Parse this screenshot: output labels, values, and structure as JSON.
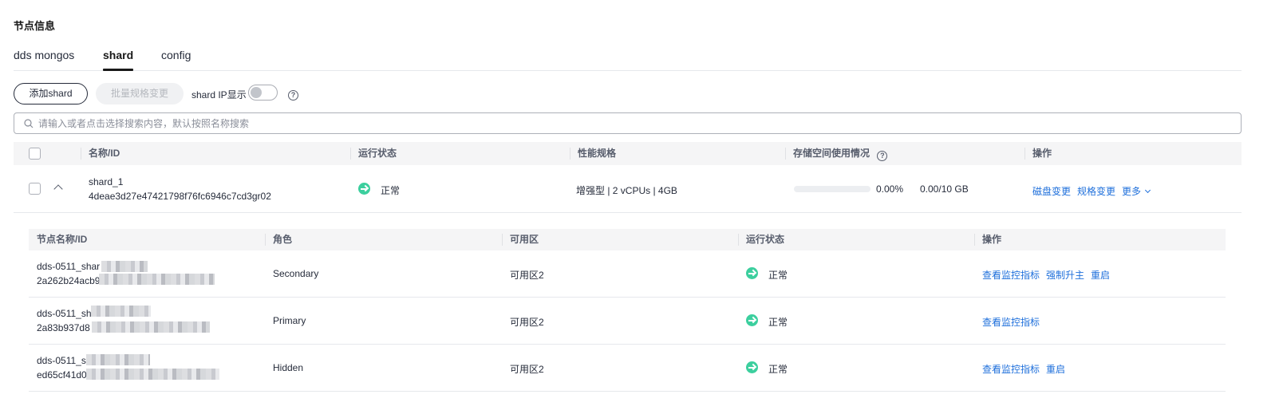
{
  "section_title": "节点信息",
  "tabs": [
    {
      "label": "dds mongos",
      "active": false
    },
    {
      "label": "shard",
      "active": true
    },
    {
      "label": "config",
      "active": false
    }
  ],
  "toolbar": {
    "add_label": "添加shard",
    "batch_label": "批量规格变更",
    "toggle_label": "shard IP显示",
    "toggle_on": false
  },
  "search": {
    "placeholder": "请输入或者点击选择搜索内容，默认按照名称搜索"
  },
  "main_table": {
    "headers": [
      "名称/ID",
      "运行状态",
      "性能规格",
      "存储空间使用情况",
      "操作"
    ],
    "row": {
      "name": "shard_1",
      "id": "4deae3d27e47421798f76fc6946c7cd3gr02",
      "status": "正常",
      "spec": "增强型 | 2 vCPUs | 4GB",
      "storage_percent": "0.00%",
      "storage_fraction": 0.0,
      "storage_amount": "0.00/10 GB",
      "actions": [
        "磁盘变更",
        "规格变更",
        "更多"
      ]
    }
  },
  "sub_table": {
    "headers": [
      "节点名称/ID",
      "角色",
      "可用区",
      "运行状态",
      "操作"
    ],
    "rows": [
      {
        "name": "dds-0511_shar",
        "id": "2a262b24acb9",
        "role": "Secondary",
        "zone": "可用区2",
        "status": "正常",
        "actions": [
          "查看监控指标",
          "强制升主",
          "重启"
        ]
      },
      {
        "name": "dds-0511_sh",
        "id": "2a83b937d8",
        "role": "Primary",
        "zone": "可用区2",
        "status": "正常",
        "actions": [
          "查看监控指标"
        ]
      },
      {
        "name": "dds-0511_s",
        "id": "ed65cf41d0",
        "role": "Hidden",
        "zone": "可用区2",
        "status": "正常",
        "actions": [
          "查看监控指标",
          "重启"
        ]
      }
    ]
  },
  "colors": {
    "accent": "#1e6fdb",
    "status_ok": "#3ccf9e",
    "text": "#252b3a"
  }
}
